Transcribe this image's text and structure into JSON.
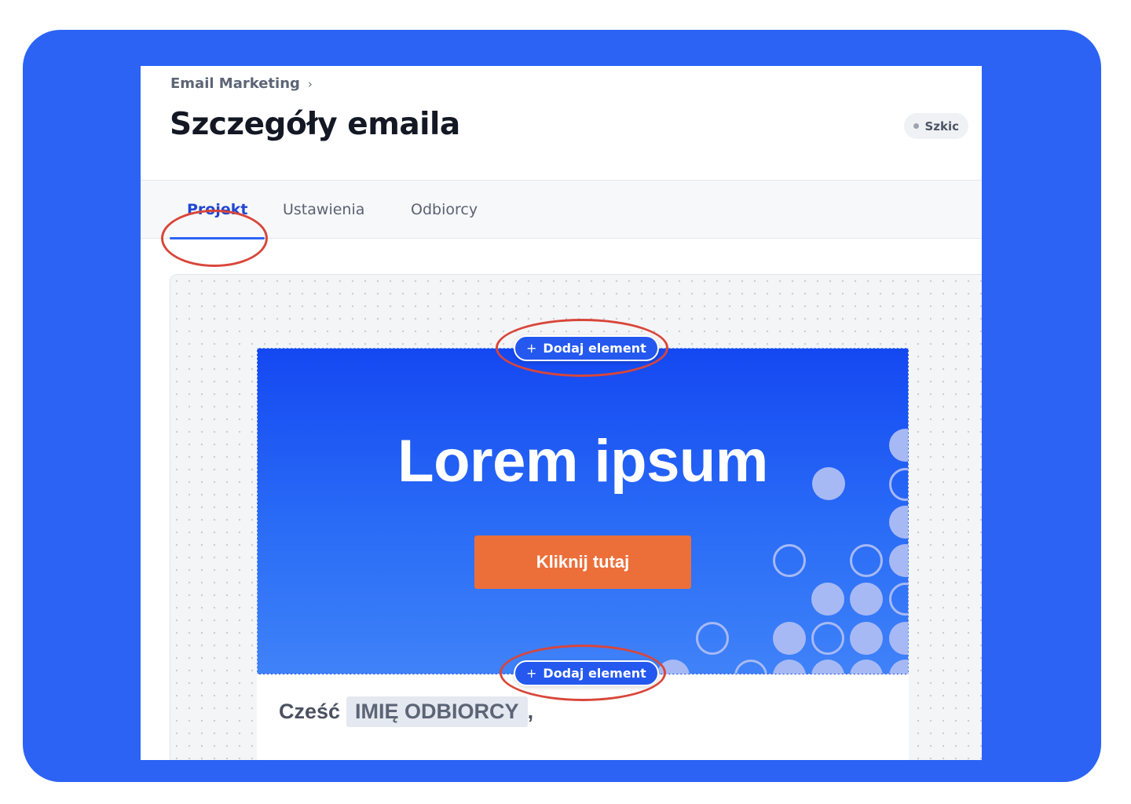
{
  "breadcrumb": {
    "label": "Email Marketing",
    "separator": "›"
  },
  "page": {
    "title": "Szczegóły emaila"
  },
  "status": {
    "label": "Szkic"
  },
  "tabs": [
    {
      "label": "Projekt",
      "active": true
    },
    {
      "label": "Ustawienia",
      "active": false
    },
    {
      "label": "Odbiorcy",
      "active": false
    }
  ],
  "editor": {
    "add_element_top": "Dodaj element",
    "add_element_bottom": "Dodaj element",
    "add_element_icon": "+",
    "hero": {
      "title": "Lorem ipsum",
      "button_label": "Kliknij tutaj"
    },
    "greeting": {
      "prefix": "Cześć",
      "merge_tag": "IMIĘ ODBIORCY",
      "suffix": ","
    }
  },
  "colors": {
    "frame": "#2c63f5",
    "accent": "#2247d3",
    "cta": "#ec6f3a",
    "annotation": "#d9463a"
  }
}
